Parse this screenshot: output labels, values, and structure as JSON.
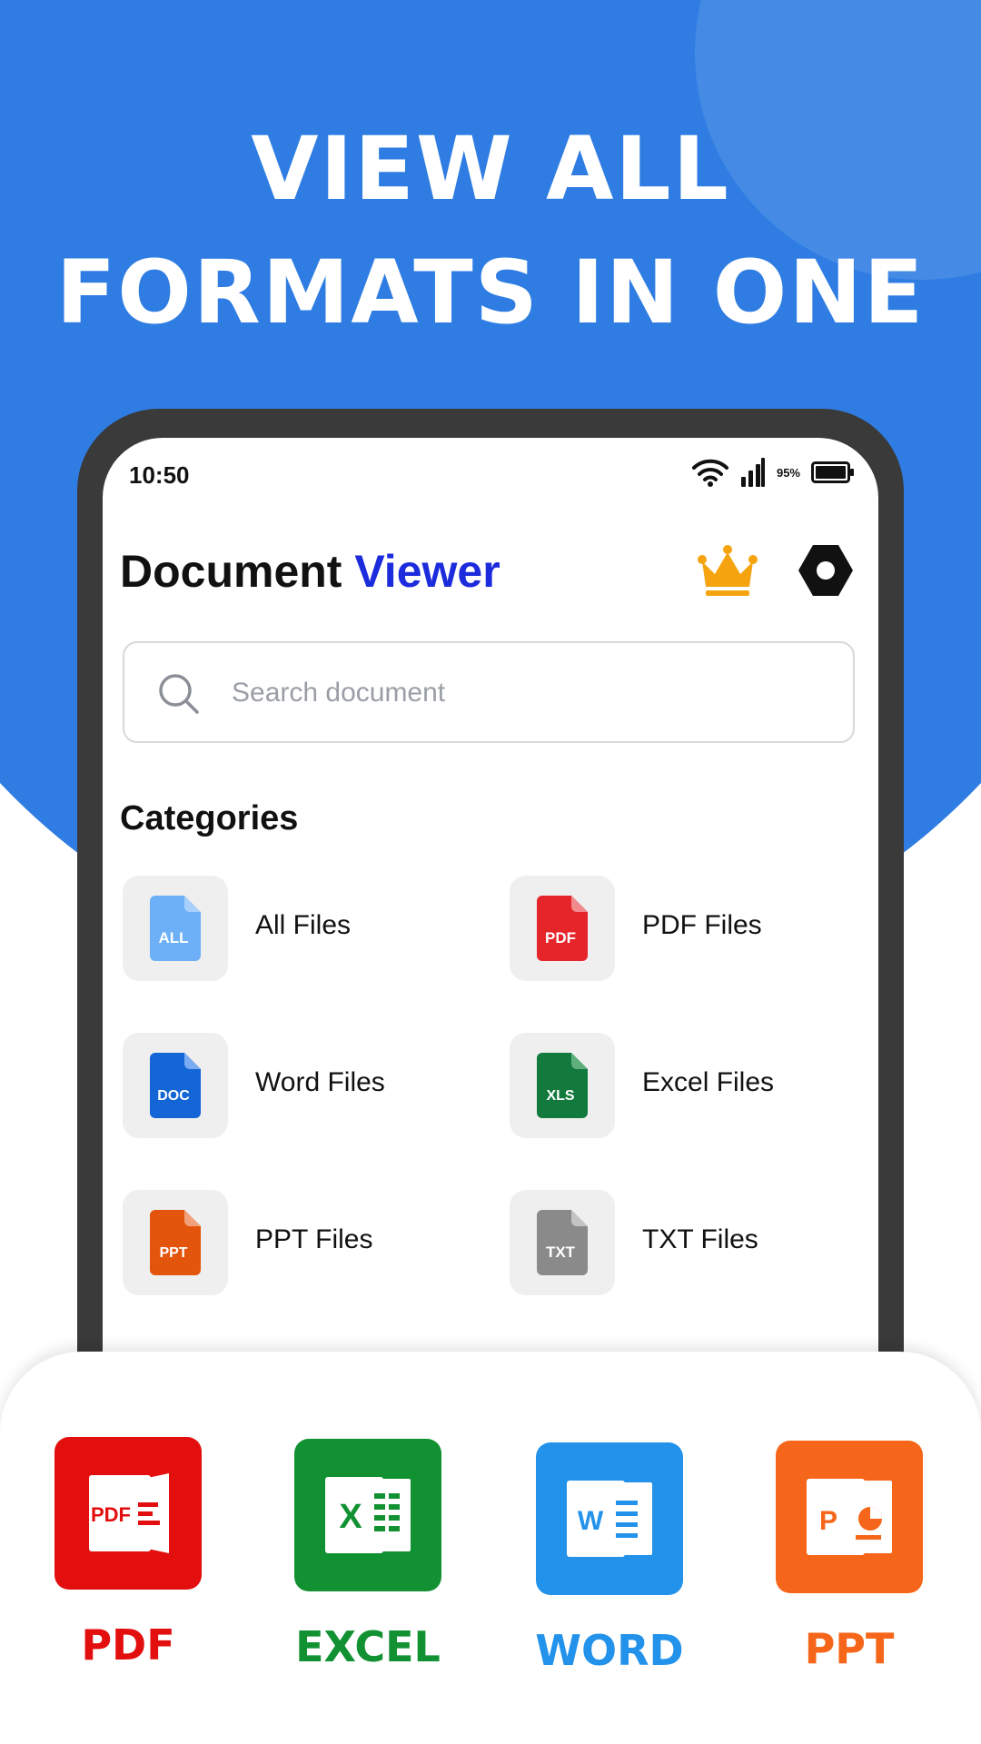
{
  "colors": {
    "brand_blue": "#2f7de3",
    "accent_title": "#1c2bdc",
    "crown": "#f5a30f",
    "pdf": "#e30e0e",
    "excel": "#119132",
    "word": "#2392eb",
    "ppt": "#f5661a"
  },
  "headline": {
    "line1": "VIEW ALL",
    "line2": "FORMATS IN ONE"
  },
  "status_bar": {
    "time": "10:50",
    "battery": "95%",
    "icons": [
      "wifi-icon",
      "signal-icon",
      "battery-icon"
    ]
  },
  "app": {
    "title_part1": "Document ",
    "title_part2": "Viewer",
    "premium_icon": "crown-icon",
    "settings_icon": "settings-icon"
  },
  "search": {
    "placeholder": "Search document",
    "icon": "search-icon"
  },
  "categories": {
    "heading": "Categories",
    "items": [
      {
        "label": "All Files",
        "badge": "ALL",
        "color": "#6db0f8"
      },
      {
        "label": "PDF Files",
        "badge": "PDF",
        "color": "#e5252a"
      },
      {
        "label": "Word Files",
        "badge": "DOC",
        "color": "#1466d6"
      },
      {
        "label": "Excel Files",
        "badge": "XLS",
        "color": "#117a3c"
      },
      {
        "label": "PPT Files",
        "badge": "PPT",
        "color": "#e3550d"
      },
      {
        "label": "TXT Files",
        "badge": "TXT",
        "color": "#8a8a8a"
      }
    ]
  },
  "formats": [
    {
      "label": "PDF",
      "icon_text": "PDF",
      "icon": "pdf-icon",
      "color": "#e30e0e"
    },
    {
      "label": "EXCEL",
      "icon_text": "X",
      "icon": "excel-icon",
      "color": "#119132"
    },
    {
      "label": "WORD",
      "icon_text": "W",
      "icon": "word-icon",
      "color": "#2392eb"
    },
    {
      "label": "PPT",
      "icon_text": "P",
      "icon": "ppt-icon",
      "color": "#f5661a"
    }
  ]
}
